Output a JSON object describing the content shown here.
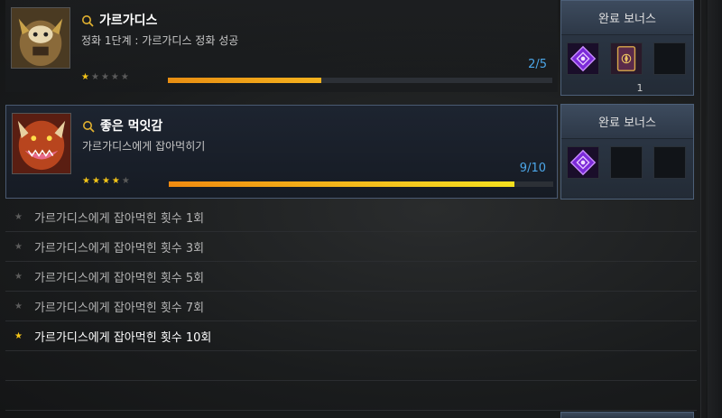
{
  "achievements": [
    {
      "title": "가르가디스",
      "desc": "정화 1단계 : 가르가디스 정화 성공",
      "count": "2/5",
      "progress": 0.4,
      "stars_filled": 1,
      "stars_total": 5,
      "bonus_label": "완료 보너스",
      "reward_qty": "1"
    },
    {
      "title": "좋은 먹잇감",
      "desc": "가르가디스에게 잡아먹히기",
      "count": "9/10",
      "progress": 0.9,
      "stars_filled": 4,
      "stars_total": 5,
      "bonus_label": "완료 보너스"
    }
  ],
  "steps": [
    {
      "label": "가르가디스에게 잡아먹힌 횟수 1회",
      "done": false
    },
    {
      "label": "가르가디스에게 잡아먹힌 횟수 3회",
      "done": false
    },
    {
      "label": "가르가디스에게 잡아먹힌 횟수 5회",
      "done": false
    },
    {
      "label": "가르가디스에게 잡아먹힌 횟수 7회",
      "done": false
    },
    {
      "label": "가르가디스에게 잡아먹힌 횟수 10회",
      "done": true
    }
  ],
  "colors": {
    "accent_blue": "#4ca6e8",
    "bar_orange": "#f5b21e",
    "star_gold": "#f5c518"
  }
}
